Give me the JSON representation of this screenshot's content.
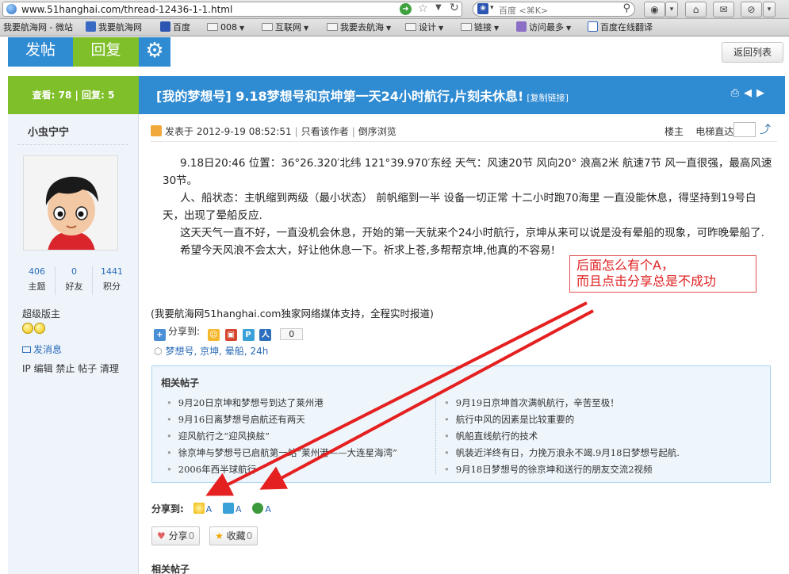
{
  "browser": {
    "url": "www.51hanghai.com/thread-12436-1-1.html",
    "search_placeholder": "百度 <⌘K>",
    "bookmarks": [
      {
        "label": "我要航海网 - 微站",
        "dropdown": false
      },
      {
        "label": "我要航海网",
        "dropdown": false
      },
      {
        "label": "百度",
        "dropdown": false
      },
      {
        "label": "008",
        "dropdown": true
      },
      {
        "label": "互联网",
        "dropdown": true
      },
      {
        "label": "我要去航海",
        "dropdown": true
      },
      {
        "label": "设计",
        "dropdown": true
      },
      {
        "label": "链接",
        "dropdown": true
      },
      {
        "label": "访问最多",
        "dropdown": true
      },
      {
        "label": "百度在线翻译",
        "dropdown": false
      }
    ]
  },
  "toolbar": {
    "post_label": "发帖",
    "reply_label": "回复",
    "back_label": "返回列表"
  },
  "thread": {
    "stats": "查看: 78 | 回复: 5",
    "title": "[我的梦想号] 9.18梦想号和京坤第一天24小时航行,片刻未休息!",
    "copy_link": "[复制链接]"
  },
  "author": {
    "name": "小虫宁宁",
    "stats": [
      {
        "value": "406",
        "label": "主题"
      },
      {
        "value": "0",
        "label": "好友"
      },
      {
        "value": "1441",
        "label": "积分"
      }
    ],
    "role": "超级版主",
    "send_message": "发消息",
    "admin_links": "IP 编辑 禁止 帖子 清理"
  },
  "post": {
    "posted_at": "发表于 2012-9-19 08:52:51",
    "author_only": "只看该作者",
    "reverse": "倒序浏览",
    "floor": "楼主",
    "elevator": "电梯直达",
    "paragraphs": [
      "9.18日20:46 位置：36°26.320′北纬 121°39.970′东经 天气：风速20节 风向20° 浪高2米 航速7节 风一直很强，最高风速30节。",
      "人、船状态：主帆缩到两级（最小状态） 前帆缩到一半 设备一切正常 十二小时跑70海里 一直没能休息，得坚持到19号白天，出现了晕船反应.",
      "这天天气一直不好，一直没机会休息，开始的第一天就来个24小时航行，京坤从来可以说是没有晕船的现象，可昨晚晕船了.",
      "希望今天风浪不会太大，好让他休息一下。祈求上苍,多帮帮京坤,他真的不容易!"
    ],
    "support_note": "(我要航海网51hanghai.com独家网络媒体支持，全程实时报道)",
    "share_label": "分享到:",
    "share_count": "0",
    "tags": [
      "梦想号",
      "京坤",
      "晕船",
      "24h"
    ]
  },
  "related": {
    "heading": "相关帖子",
    "left": [
      "9月20日京坤和梦想号到达了莱州港",
      "9月16日离梦想号启航还有两天",
      "迎风航行之“迎风换舷”",
      "徐京坤与梦想号已启航第一站“莱州港——大连星海湾”",
      "2006年西半球航行"
    ],
    "right": [
      "9月19日京坤首次满帆航行，辛苦至极！",
      "航行中风的因素是比较重要的",
      "帆船直线航行的技术",
      "帆装近洋终有日，力挽万浪永不竭.9月18日梦想号起航.",
      "9月18日梦想号的徐京坤和送行的朋友交流2视频"
    ]
  },
  "share_bottom": {
    "label": "分享到:",
    "items": [
      "A",
      "A",
      "A"
    ]
  },
  "actions": {
    "share_label": "分享",
    "share_count": "0",
    "favorite_label": "收藏",
    "favorite_count": "0"
  },
  "related_bottom": "相关帖子",
  "annotation": {
    "line1": "后面怎么有个A，",
    "line2": "而且点击分享总是不成功",
    "color": "#e02020"
  }
}
